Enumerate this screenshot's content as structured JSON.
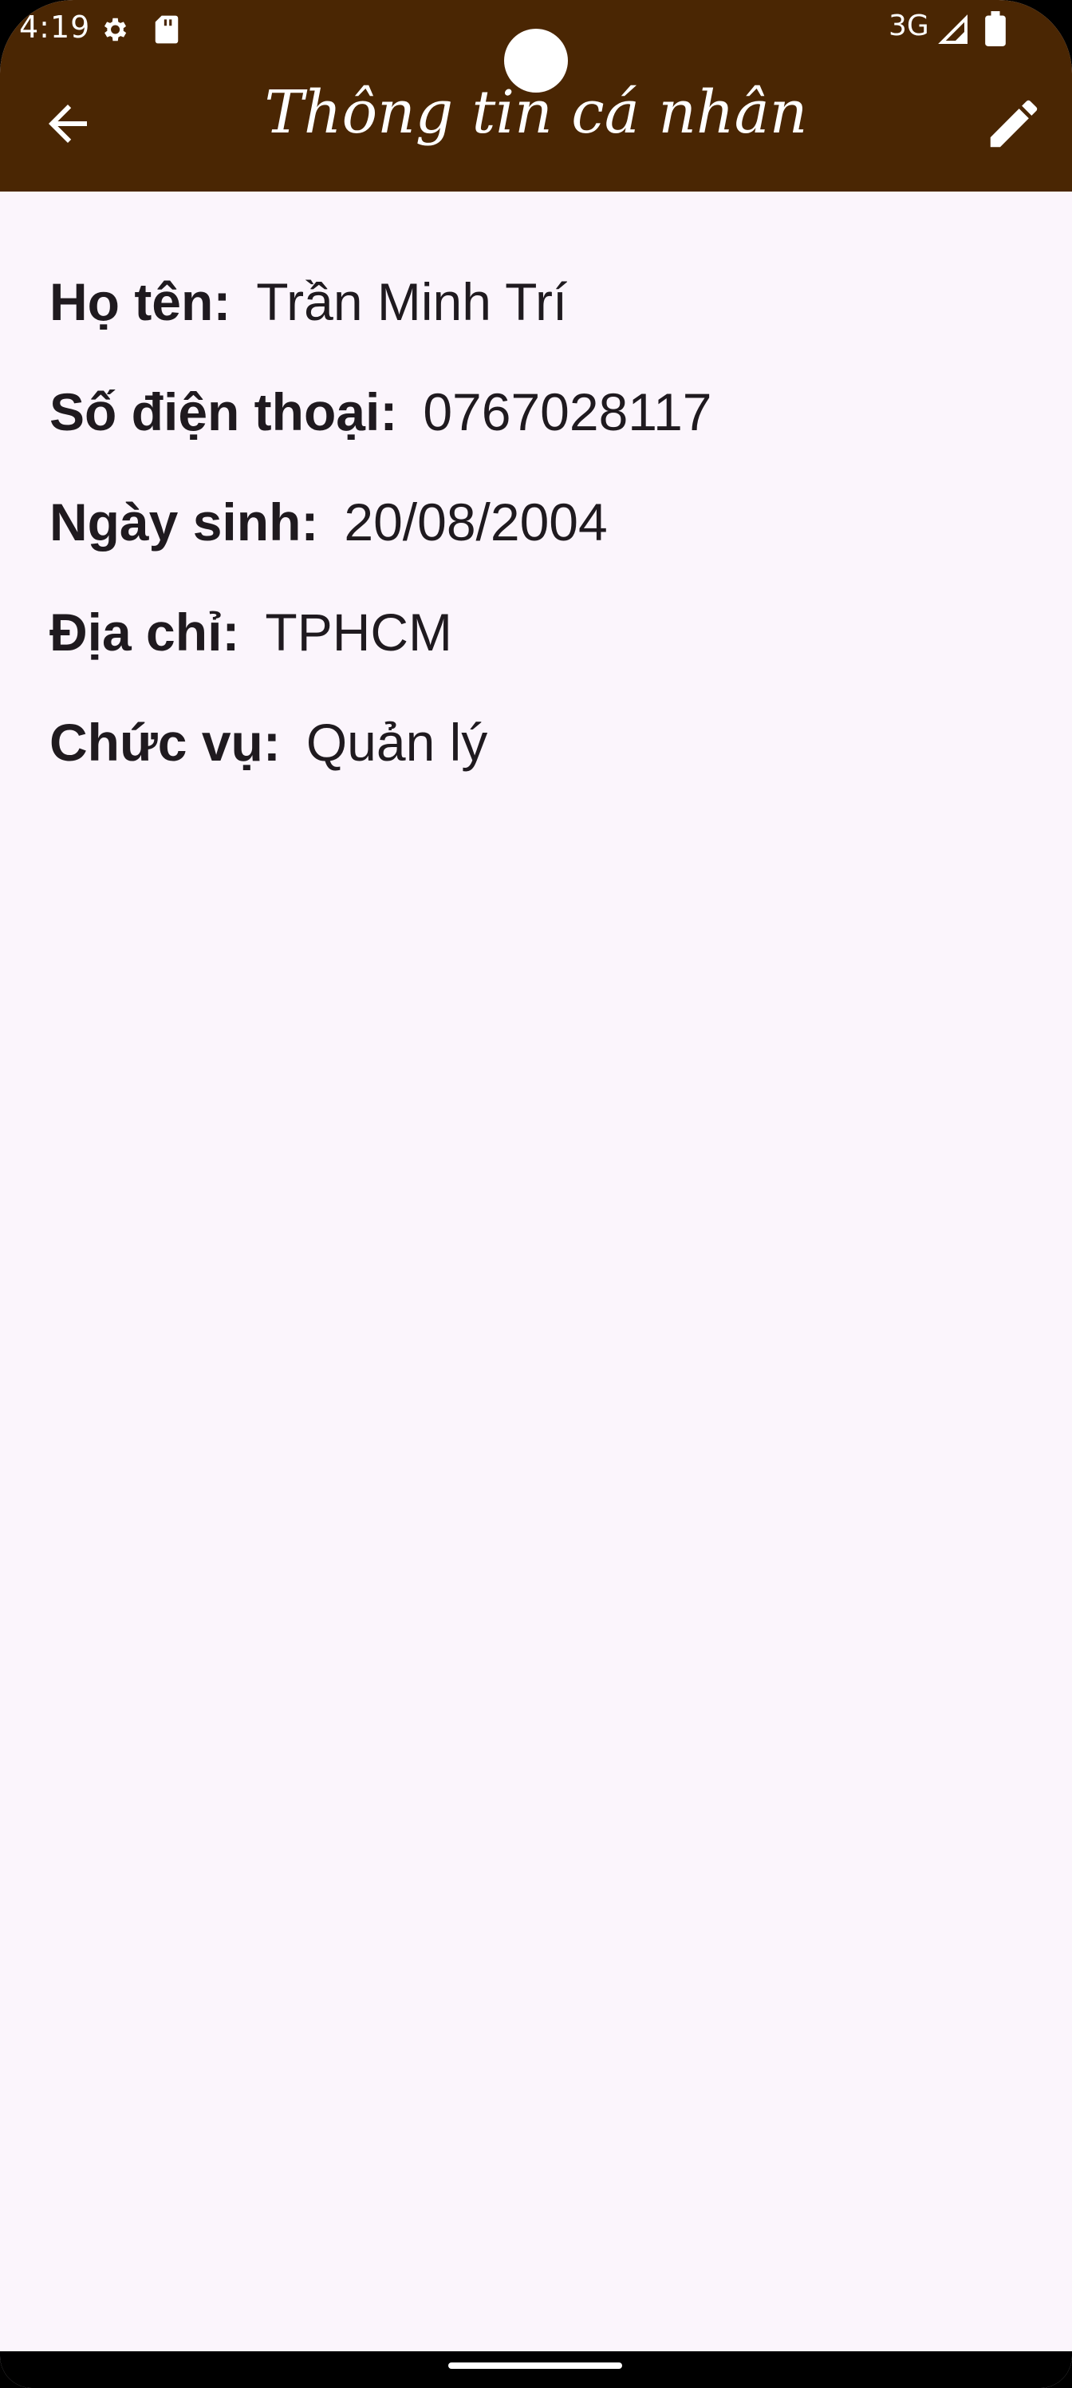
{
  "status_bar": {
    "time": "4:19",
    "network": "3G",
    "icons": [
      "gear-icon",
      "sd-card-icon",
      "signal-icon",
      "battery-icon"
    ]
  },
  "app_bar": {
    "title": "Thông tin cá nhân",
    "back_icon": "arrow-left-icon",
    "edit_icon": "pencil-icon",
    "background_color": "#4a2603"
  },
  "profile": {
    "fields": [
      {
        "label": "Họ tên:",
        "value": "Trần Minh Trí"
      },
      {
        "label": "Số điện thoại:",
        "value": "0767028117"
      },
      {
        "label": "Ngày sinh:",
        "value": "20/08/2004"
      },
      {
        "label": "Địa chỉ:",
        "value": "TPHCM"
      },
      {
        "label": "Chức vụ:",
        "value": "Quản lý"
      }
    ]
  }
}
